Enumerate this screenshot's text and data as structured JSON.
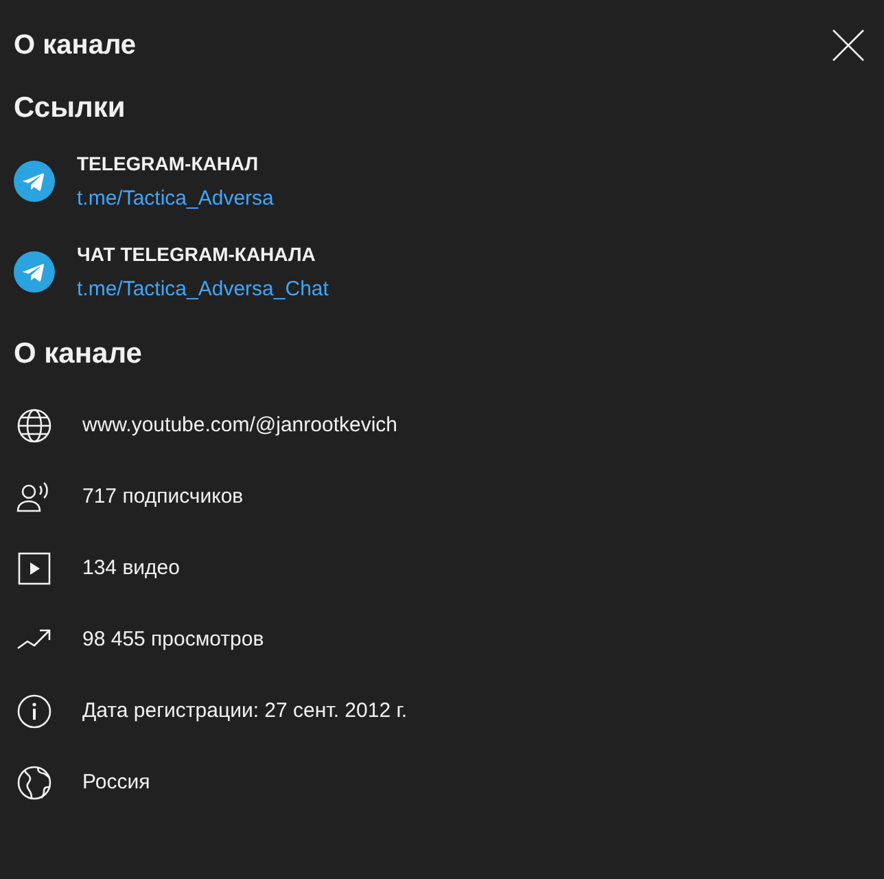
{
  "dialog": {
    "title": "О канале"
  },
  "links_section": {
    "heading": "Ссылки",
    "links": [
      {
        "kind": "telegram",
        "title": "TELEGRAM-КАНАЛ",
        "url": "t.me/Tactica_Adversa"
      },
      {
        "kind": "telegram",
        "title": "ЧАТ TELEGRAM-КАНАЛА",
        "url": "t.me/Tactica_Adversa_Chat"
      }
    ]
  },
  "about_section": {
    "heading": "О канале",
    "details": [
      {
        "kind": "globe",
        "text": "www.youtube.com/@janrootkevich"
      },
      {
        "kind": "subscribers",
        "text": "717 подписчиков"
      },
      {
        "kind": "video",
        "text": "134 видео"
      },
      {
        "kind": "views",
        "text": "98 455 просмотров"
      },
      {
        "kind": "info",
        "text": "Дата регистрации: 27 сент. 2012 г."
      },
      {
        "kind": "country",
        "text": "Россия"
      }
    ]
  }
}
